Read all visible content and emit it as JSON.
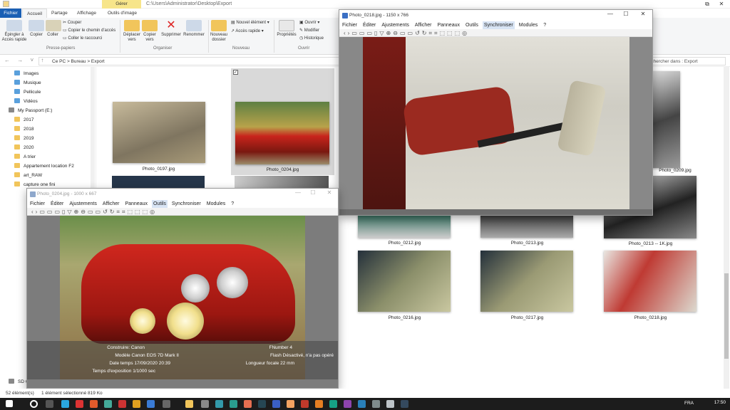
{
  "titlebar": {
    "path": "C:\\Users\\Administrator\\Desktop\\Export",
    "manage_label": "Gérer"
  },
  "ribbon": {
    "tabs": [
      "Fichier",
      "Accueil",
      "Partage",
      "Affichage",
      "Outils d'image"
    ],
    "pin": "Épingler à Accès rapide",
    "copy": "Copier",
    "paste": "Coller",
    "cut": "Couper",
    "copy_path": "Copier le chemin d'accès",
    "paste_shortcut": "Coller le raccourci",
    "move_to": "Déplacer vers",
    "copy_to": "Copier vers",
    "delete": "Supprimer",
    "rename": "Renommer",
    "new_folder": "Nouveau dossier",
    "new_item": "Nouvel élément",
    "easy_access": "Accès rapide",
    "properties": "Propriétés",
    "open": "Ouvrir",
    "modify": "Modifier",
    "history": "Historique",
    "groups": {
      "clipboard": "Presse-papiers",
      "organize": "Organiser",
      "new": "Nouveau",
      "open": "Ouvrir"
    }
  },
  "address": {
    "crumbs": "Ce PC  >  Bureau  >  Export",
    "search_placeholder": "Rechercher dans : Export"
  },
  "nav": {
    "items": [
      "Images",
      "Musique",
      "Pellicule",
      "Vidéos",
      "My Passport (E:)",
      "2017",
      "2018",
      "2019",
      "2020",
      "A trier",
      "Appartement location F2",
      "art_RAW",
      "capture one fini",
      "SD Card (D:)"
    ]
  },
  "files": {
    "labels": [
      "Photo_0197.jpg",
      "Photo_0204.jpg",
      "Photo_0209.jpg",
      "Photo_0212.jpg",
      "Photo_0213.jpg",
      "Photo_0213 -- 1K.jpg",
      "Photo_0216.jpg",
      "Photo_0217.jpg",
      "Photo_0218.jpg"
    ]
  },
  "viewer1": {
    "title": "Photo_0204.jpg - 1000 x 667",
    "menu": [
      "Fichier",
      "Éditer",
      "Ajustements",
      "Afficher",
      "Panneaux",
      "Outils",
      "Synchroniser",
      "Modules",
      "?"
    ],
    "exif": {
      "construct": "Construire: Canon",
      "model": "Modèle  Canon EOS 7D Mark II",
      "datetime": "Date temps  17/09/2020 20:39",
      "exposure": "Temps d'exposition  1/1000 sec",
      "fnumber": "FNumber  4",
      "flash": "Flash  Désactivé, n'a pas opéré",
      "focal": "Longueur focale  22 mm"
    }
  },
  "viewer2": {
    "title": "Photo_0218.jpg - 1150 x 766",
    "menu": [
      "Fichier",
      "Éditer",
      "Ajustements",
      "Afficher",
      "Panneaux",
      "Outils",
      "Synchroniser",
      "Modules",
      "?"
    ]
  },
  "status": {
    "count": "52 élément(s)",
    "selected": "1 élément sélectionné  819 Ko"
  },
  "taskbar": {
    "lang": "FRA",
    "time": "17:50"
  }
}
